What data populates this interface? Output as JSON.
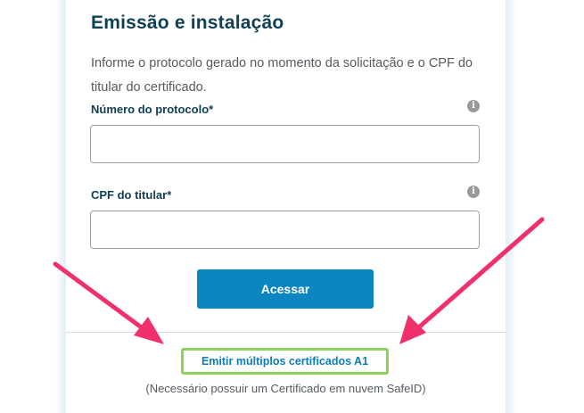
{
  "title": "Emissão e instalação",
  "description": "Informe o protocolo gerado no momento da solicitação e o CPF do titular do certificado.",
  "fields": {
    "protocol": {
      "label": "Número do protocolo*",
      "value": ""
    },
    "cpf": {
      "label": "CPF do titular*",
      "value": ""
    }
  },
  "info_icon_glyph": "i",
  "submit_label": "Acessar",
  "multi_link_label": "Emitir múltiplos certificados A1",
  "multi_link_note": "(Necessário possuir um Certificado em nuvem SafeID)",
  "colors": {
    "title": "#0f3f55",
    "button": "#0b86c1",
    "link": "#0b7db5",
    "highlight_box": "#8bd35a",
    "annotation_arrow": "#f0306a"
  },
  "annotations": [
    "arrow-pointing-at-link",
    "arrow-pointing-at-link"
  ]
}
